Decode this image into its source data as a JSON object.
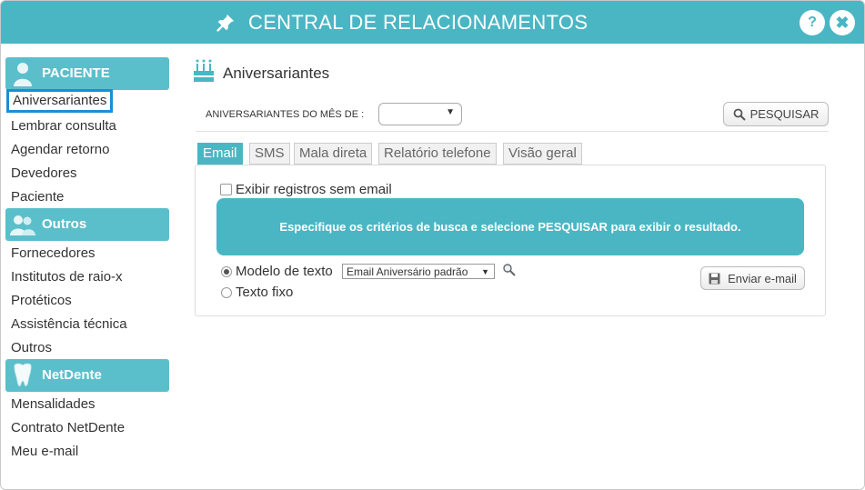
{
  "window": {
    "title": "CENTRAL DE RELACIONAMENTOS",
    "help_label": "?",
    "close_label": "✖"
  },
  "sidebar": {
    "sections": [
      {
        "label": "PACIENTE",
        "icon": "patient-icon"
      },
      {
        "label": "Outros",
        "icon": "people-icon"
      },
      {
        "label": "NetDente",
        "icon": "tooth-icon"
      }
    ],
    "paciente_items": [
      "Aniversariantes",
      "Lembrar consulta",
      "Agendar retorno",
      "Devedores",
      "Paciente"
    ],
    "outros_items": [
      "Fornecedores",
      "Institutos de raio-x",
      "Protéticos",
      "Assistência técnica",
      "Outros"
    ],
    "netdente_items": [
      "Mensalidades",
      "Contrato NetDente",
      "Meu e-mail"
    ]
  },
  "main": {
    "title": "Aniversariantes",
    "filter_label": "ANIVERSARIANTES DO MÊS DE :",
    "month_value": "",
    "search_label": "PESQUISAR",
    "tabs": [
      "Email",
      "SMS",
      "Mala direta",
      "Relatório telefone",
      "Visão geral"
    ],
    "active_tab": "Email",
    "checkbox_label": "Exibir registros sem email",
    "info_message": "Especifique os critérios de busca e selecione PESQUISAR para exibir o resultado.",
    "radio_template_label": "Modelo de texto",
    "template_value": "Email Aniversário padrão",
    "radio_fixed_label": "Texto fixo",
    "send_label": "Enviar e-mail"
  },
  "colors": {
    "accent": "#4ab6c4",
    "active_outline": "#1a8fd6"
  }
}
